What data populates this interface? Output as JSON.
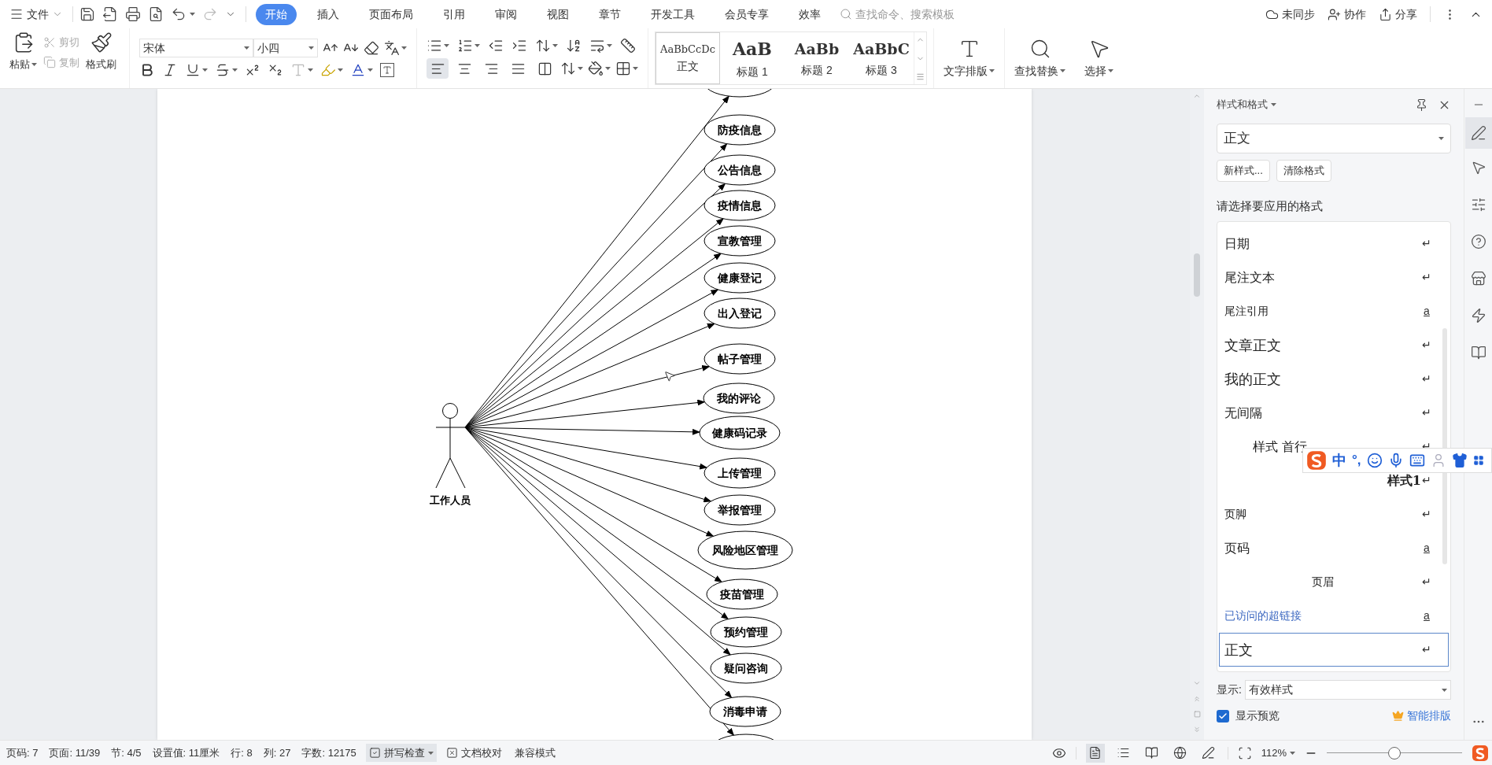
{
  "menu": {
    "label": "文件"
  },
  "tabs": [
    {
      "label": "开始",
      "selected": true
    },
    {
      "label": "插入",
      "selected": false
    },
    {
      "label": "页面布局",
      "selected": false
    },
    {
      "label": "引用",
      "selected": false
    },
    {
      "label": "审阅",
      "selected": false
    },
    {
      "label": "视图",
      "selected": false
    },
    {
      "label": "章节",
      "selected": false
    },
    {
      "label": "开发工具",
      "selected": false
    },
    {
      "label": "会员专享",
      "selected": false
    },
    {
      "label": "效率",
      "selected": false
    }
  ],
  "search": {
    "placeholder": "查找命令、搜索模板"
  },
  "top_actions": [
    {
      "kind": "sync",
      "label": "未同步"
    },
    {
      "kind": "collab",
      "label": "协作"
    },
    {
      "kind": "share",
      "label": "分享"
    }
  ],
  "clipboard": {
    "paste": "粘贴",
    "cut": {
      "label": "剪切",
      "disabled": true
    },
    "copy": {
      "label": "复制",
      "disabled": true
    },
    "painter": "格式刷"
  },
  "font": {
    "name": "宋体",
    "size": "小四"
  },
  "alignment": [
    {
      "kind": "left",
      "selected": true
    },
    {
      "kind": "center",
      "selected": false
    },
    {
      "kind": "right",
      "selected": false
    },
    {
      "kind": "justify",
      "selected": false
    },
    {
      "kind": "distribute",
      "selected": false
    }
  ],
  "styles_gallery": [
    {
      "preview": "AaBbCcDc",
      "label": "正文",
      "selected": true
    },
    {
      "preview": "AaB",
      "label": "标题 1",
      "selected": false
    },
    {
      "preview": "AaBb",
      "label": "标题 2",
      "selected": false
    },
    {
      "preview": "AaBbC",
      "label": "标题 3",
      "selected": false
    }
  ],
  "tools": [
    {
      "kind": "layout",
      "label": "文字排版"
    },
    {
      "kind": "find",
      "label": "查找替换"
    },
    {
      "kind": "select",
      "label": "选择"
    }
  ],
  "diagram": {
    "actor": "工作人员",
    "use_cases": [
      "防疫信息",
      "公告信息",
      "疫情信息",
      "宣教管理",
      "健康登记",
      "出入登记",
      "帖子管理",
      "我的评论",
      "健康码记录",
      "上传管理",
      "举报管理",
      "风险地区管理",
      "疫苗管理",
      "预约管理",
      "疑问咨询",
      "消毒申请"
    ]
  },
  "panel": {
    "title": "样式和格式",
    "current_style": "正文",
    "buttons": [
      "新样式...",
      "清除格式"
    ],
    "prompt": "请选择要应用的格式",
    "styles": [
      {
        "label": "日期",
        "marker": "↵",
        "kind": "paragraph",
        "serif": true,
        "selected": false
      },
      {
        "label": "尾注文本",
        "marker": "↵",
        "kind": "paragraph",
        "serif": true,
        "selected": false
      },
      {
        "label": "尾注引用",
        "marker": "a",
        "kind": "character",
        "serif": false,
        "selected": false
      },
      {
        "label": "文章正文",
        "marker": "↵",
        "kind": "paragraph",
        "serif": true,
        "large": true,
        "selected": false
      },
      {
        "label": "我的正文",
        "marker": "↵",
        "kind": "paragraph",
        "serif": true,
        "large": true,
        "selected": false
      },
      {
        "label": "无间隔",
        "marker": "↵",
        "kind": "paragraph",
        "serif": true,
        "selected": false
      },
      {
        "label": "样式 首行",
        "marker": "↵",
        "kind": "paragraph",
        "serif": true,
        "indented": true,
        "selected": false
      },
      {
        "label": "样式1",
        "marker": "↵",
        "kind": "paragraph",
        "serif": true,
        "bold": true,
        "right_aligned": true,
        "selected": false
      },
      {
        "label": "页脚",
        "marker": "↵",
        "kind": "paragraph",
        "serif": false,
        "selected": false
      },
      {
        "label": "页码",
        "marker": "a",
        "kind": "character",
        "serif": true,
        "selected": false
      },
      {
        "label": "页眉",
        "marker": "↵",
        "kind": "paragraph",
        "serif": false,
        "centered": true,
        "selected": false
      },
      {
        "label": "已访问的超链接",
        "marker": "a",
        "kind": "character",
        "serif": false,
        "link": true,
        "selected": false
      },
      {
        "label": "正文",
        "marker": "↵",
        "kind": "paragraph",
        "serif": true,
        "large": true,
        "selected": true
      }
    ],
    "show_label": "显示:",
    "show_value": "有效样式",
    "preview": {
      "label": "显示预览",
      "checked": true
    },
    "smart_layout": "智能排版"
  },
  "ime": {
    "mode": "中",
    "punct": "°,"
  },
  "status_bar": {
    "items": [
      "页码: 7",
      "页面: 11/39",
      "节: 4/5",
      "设置值: 11厘米",
      "行: 8",
      "列: 27",
      "字数: 12175"
    ],
    "tools": [
      {
        "kind": "spell",
        "label": "拼写检查"
      },
      {
        "kind": "proof",
        "label": "文档校对"
      },
      {
        "kind": "plain",
        "label": "兼容模式"
      }
    ],
    "views": [
      {
        "kind": "page",
        "selected": true
      },
      {
        "kind": "outline",
        "selected": false
      },
      {
        "kind": "read",
        "selected": false
      },
      {
        "kind": "web",
        "selected": false
      },
      {
        "kind": "write",
        "selected": false
      }
    ],
    "zoom": "112%",
    "zoom_slider": {
      "level": 0.5
    }
  }
}
